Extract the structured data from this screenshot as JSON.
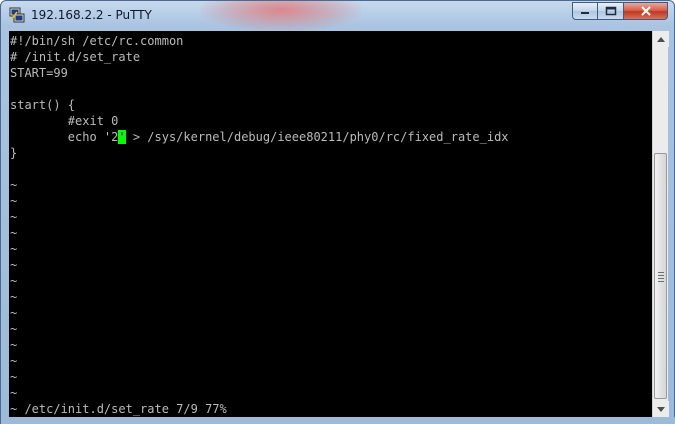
{
  "window": {
    "title": "192.168.2.2 - PuTTY",
    "icon": "putty-icon"
  },
  "caption_buttons": {
    "minimize": "minimize-icon",
    "maximize": "maximize-icon",
    "close": "close-icon"
  },
  "terminal": {
    "lines": [
      "#!/bin/sh /etc/rc.common",
      "# /init.d/set_rate",
      "START=99",
      "",
      "start() {",
      "        #exit 0",
      "        echo '2",
      "}",
      "",
      "~",
      "~",
      "~",
      "~",
      "~",
      "~",
      "~",
      "~",
      "~",
      "~",
      "~",
      "~",
      "~",
      "~",
      "~ /etc/init.d/set_rate 7/9 77%"
    ],
    "cursor_char": "'",
    "after_cursor": " > /sys/kernel/debug/ieee80211/phy0/rc/fixed_rate_idx",
    "cursor_color": "#00ff00",
    "text_color": "#bbbbbb",
    "background": "#000000"
  },
  "scrollbar": {
    "up": "scroll-up-arrow-icon",
    "down": "scroll-down-arrow-icon"
  }
}
